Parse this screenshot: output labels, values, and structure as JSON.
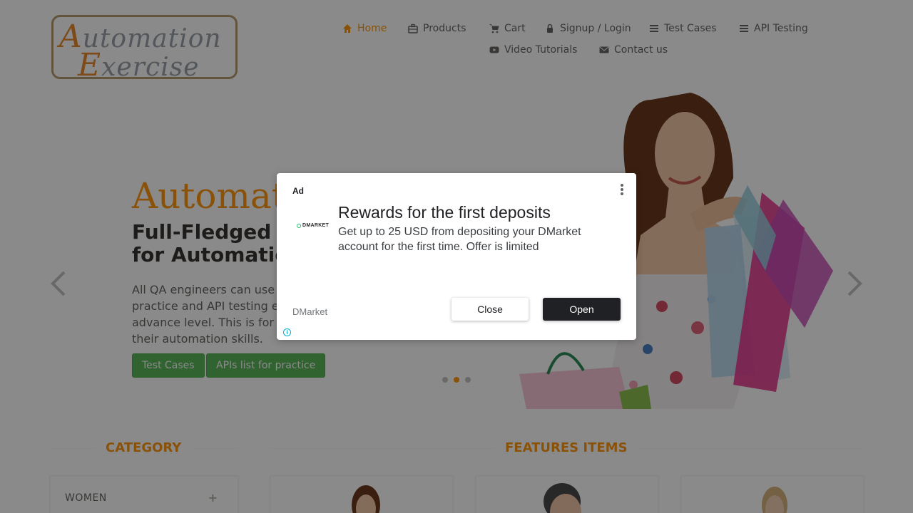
{
  "logo": {
    "line1_cap": "A",
    "line1_rest": "utomation",
    "line2_cap": "E",
    "line2_rest": "xercise"
  },
  "nav": {
    "home": "Home",
    "products": "Products",
    "cart": "Cart",
    "login": "Signup / Login",
    "test_cases": "Test Cases",
    "api_testing": "API Testing",
    "video": "Video Tutorials",
    "contact": "Contact us"
  },
  "hero": {
    "title": "Automat",
    "subtitle_line1": "Full-Fledged",
    "subtitle_line2": "for Automatic",
    "desc_line1": "All QA engineers can use",
    "desc_line2": "practice and API testing e",
    "desc_line3": "advance level. This is for",
    "desc_line4": "their automation skills.",
    "btn_test_cases": "Test Cases",
    "btn_apis": "APIs list for practice",
    "active_slide": 2,
    "slide_count": 3
  },
  "sections": {
    "category": "CATEGORY",
    "features": "FEATURES ITEMS",
    "category_items": [
      "WOMEN"
    ],
    "plus": "+"
  },
  "ad": {
    "label": "Ad",
    "logo_text": "DMARKET",
    "headline": "Rewards for the first deposits",
    "body": "Get up to 25 USD from depositing your DMarket account for the first time. Offer is limited",
    "brand": "DMarket",
    "close_label": "Close",
    "open_label": "Open",
    "info_icon": "i"
  },
  "colors": {
    "accent": "#fe980f",
    "button_green": "#5cb85c",
    "overlay": "rgba(0,0,0,0.46)"
  }
}
